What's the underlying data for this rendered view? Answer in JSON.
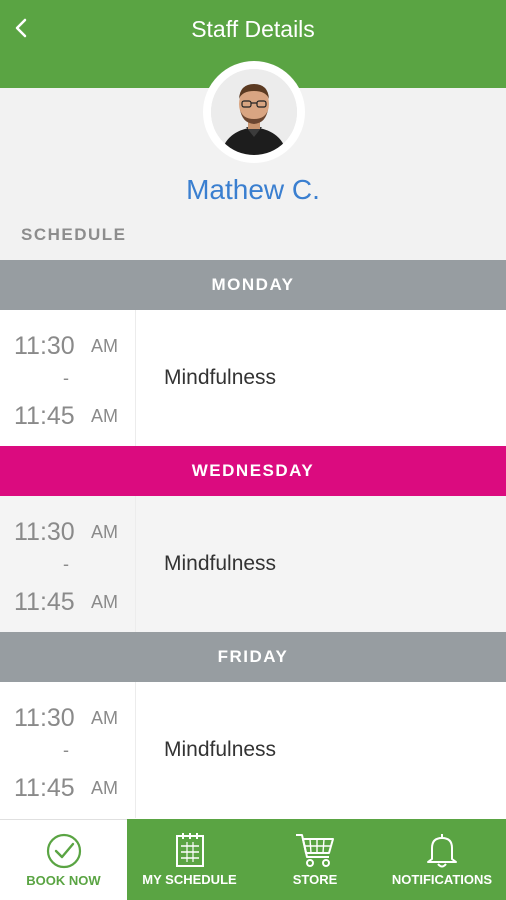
{
  "header": {
    "title": "Staff Details"
  },
  "staff": {
    "name": "Mathew C.",
    "schedule_label": "SCHEDULE"
  },
  "days": [
    {
      "day": "MONDAY",
      "header_color": "#979da1",
      "start_time": "11:30",
      "start_ampm": "AM",
      "dash": "-",
      "end_time": "11:45",
      "end_ampm": "AM",
      "class_name": "Mindfulness"
    },
    {
      "day": "WEDNESDAY",
      "header_color": "#db0b7f",
      "start_time": "11:30",
      "start_ampm": "AM",
      "dash": "-",
      "end_time": "11:45",
      "end_ampm": "AM",
      "class_name": "Mindfulness"
    },
    {
      "day": "FRIDAY",
      "header_color": "#979da1",
      "start_time": "11:30",
      "start_ampm": "AM",
      "dash": "-",
      "end_time": "11:45",
      "end_ampm": "AM",
      "class_name": "Mindfulness"
    }
  ],
  "tabs": [
    {
      "label": "BOOK NOW",
      "icon": "check-circle-icon",
      "active": true
    },
    {
      "label": "MY SCHEDULE",
      "icon": "calendar-icon",
      "active": false
    },
    {
      "label": "STORE",
      "icon": "cart-icon",
      "active": false
    },
    {
      "label": "NOTIFICATIONS",
      "icon": "bell-icon",
      "active": false
    }
  ],
  "colors": {
    "brand_green": "#5aa443",
    "staff_name_blue": "#3a7fd0",
    "wednesday_magenta": "#db0b7f",
    "day_gray": "#979da1"
  }
}
